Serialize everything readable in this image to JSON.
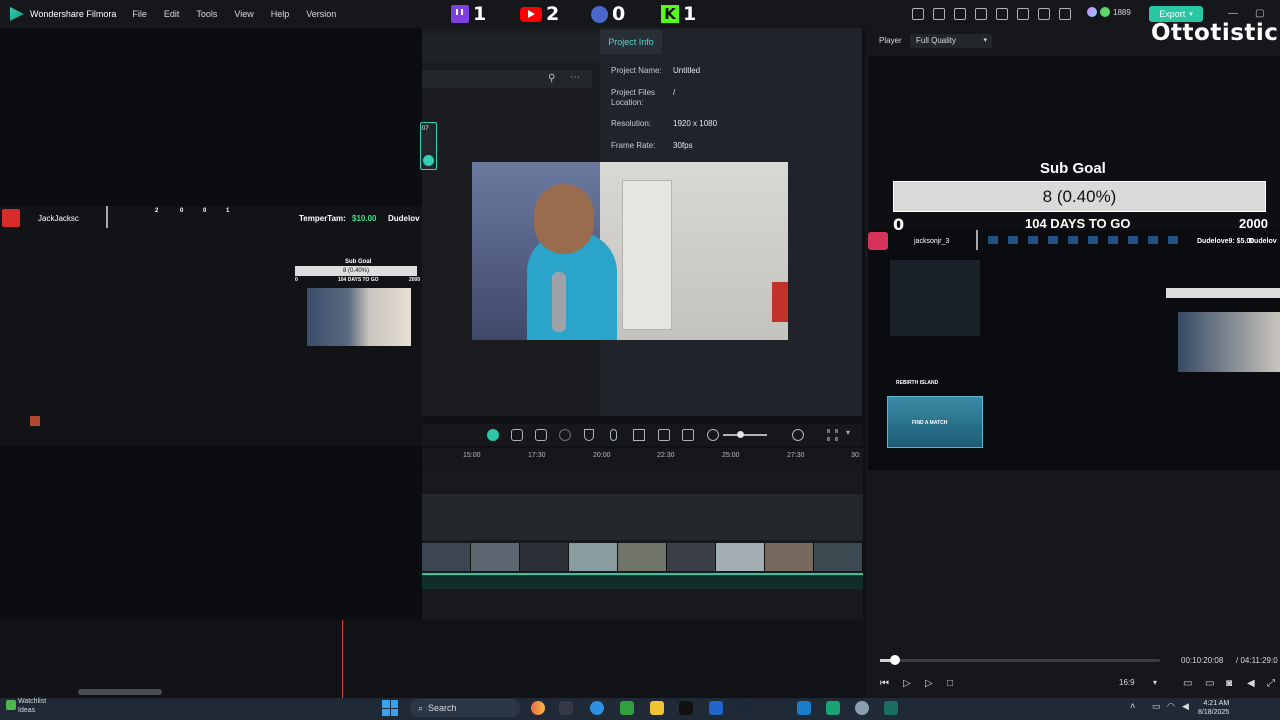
{
  "app": {
    "name": "Wondershare Filmora",
    "menu": [
      "File",
      "Edit",
      "Tools",
      "View",
      "Help",
      "Version"
    ]
  },
  "overlay_counters": {
    "twitch": "1",
    "youtube": "2",
    "facebook": "0",
    "kick": "1"
  },
  "toolbar": {
    "credits": "1889",
    "export_label": "Export"
  },
  "stream_preview": {
    "channel": "JackJacksc",
    "counts": [
      "2",
      "0",
      "0",
      "1"
    ],
    "donation_name": "TemperTam:",
    "donation_amount": "$10.00",
    "donation_next": "Dudelov",
    "sub_goal_title": "Sub Goal",
    "sub_goal_value": "8 (0.40%)",
    "sub_goal_min": "0",
    "sub_goal_days": "104 DAYS TO GO",
    "sub_goal_max": "2000"
  },
  "project_info": {
    "tab": "Project Info",
    "rows": [
      {
        "label": "Project Name:",
        "value": "Untitled"
      },
      {
        "label": "Project Files Location:",
        "value": "/"
      },
      {
        "label": "Resolution:",
        "value": "1920 x 1080"
      },
      {
        "label": "Frame Rate:",
        "value": "30fps"
      }
    ]
  },
  "media_badge": "07",
  "timeline": {
    "ticks": [
      "15:00",
      "17:30",
      "20:00",
      "22:30",
      "25:00",
      "27:30",
      "30:"
    ]
  },
  "player": {
    "label": "Player",
    "quality": "Full Quality",
    "channel_overlay": "Ottotistick",
    "sub_goal_title": "Sub Goal",
    "sub_goal_value": "8 (0.40%)",
    "sub_goal_min": "0",
    "sub_goal_days": "104 DAYS TO GO",
    "sub_goal_max": "2000",
    "nested_channel": "jacksonjr_3",
    "nested_donation": "Dudelove9: $5.00",
    "nested_donation_next": "Dudelov",
    "nested_game_title": "REBIRTH ISLAND",
    "nested_game_btn": "FIND A MATCH",
    "current_time": "00:10:20:08",
    "total_time": "/ 04:11:29:0",
    "aspect": "16:9"
  },
  "taskbar": {
    "search": "Search",
    "watchlist_line1": "Watchlist",
    "watchlist_line2": "Ideas",
    "time": "4:21 AM",
    "date": "8/18/2025"
  }
}
